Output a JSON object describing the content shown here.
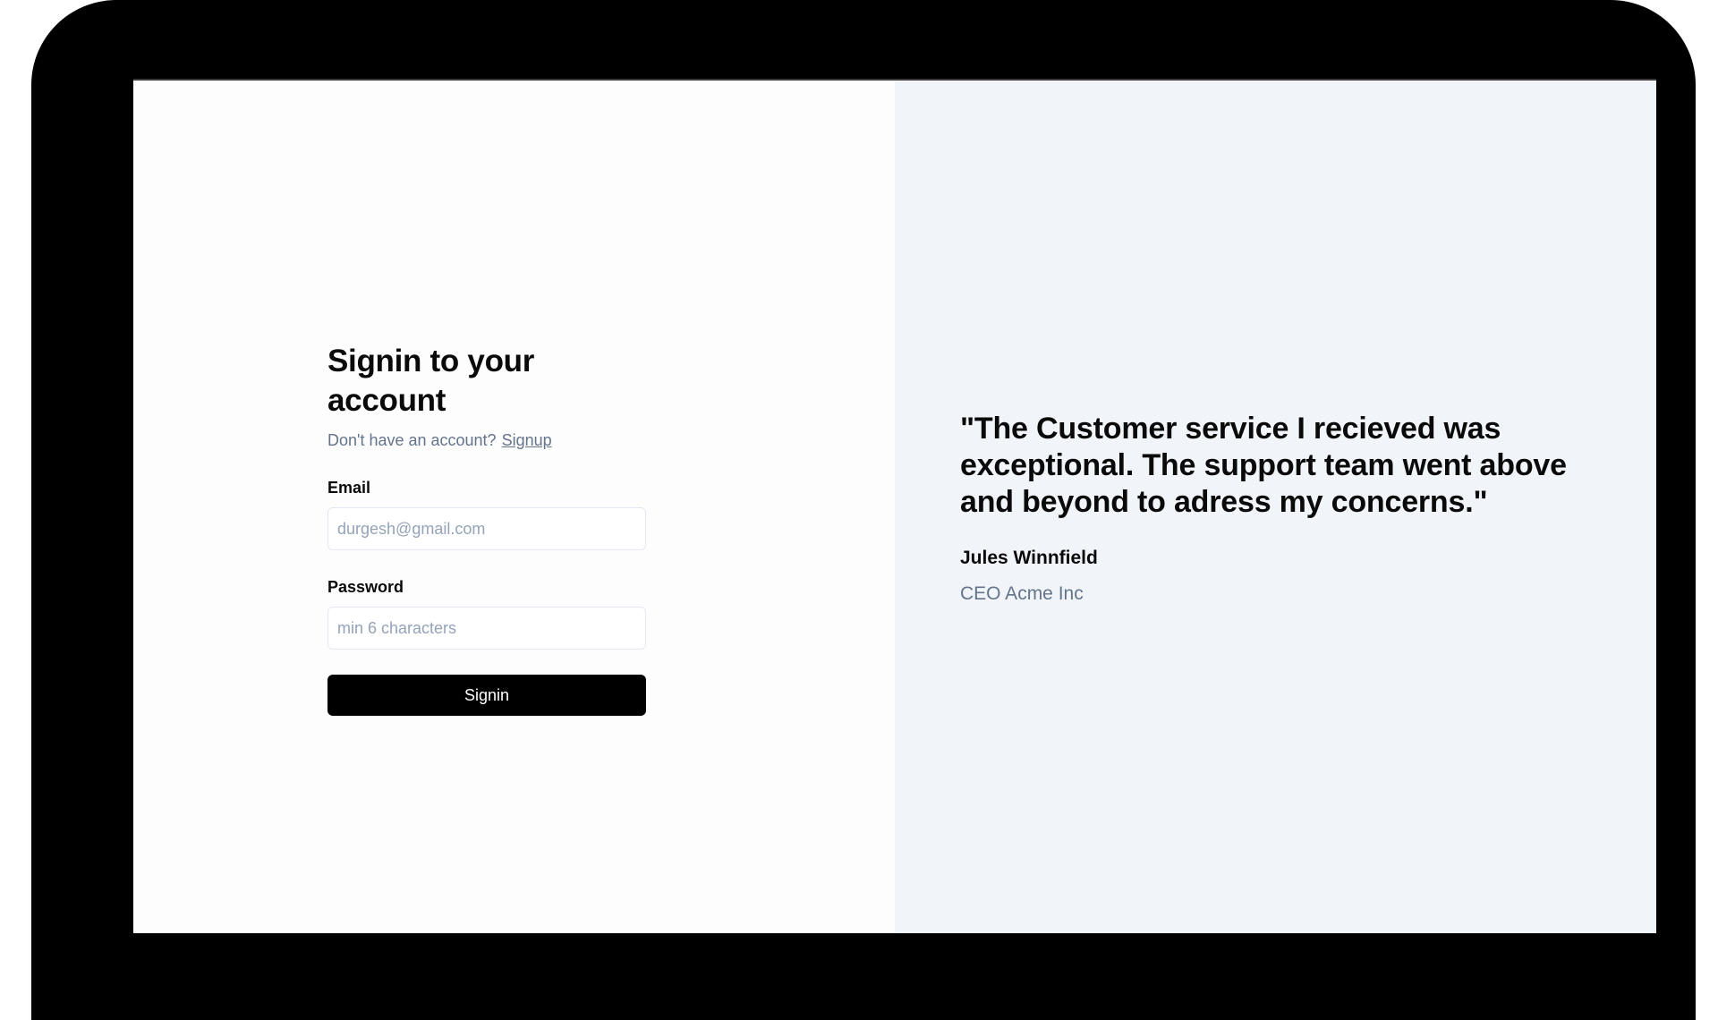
{
  "signin": {
    "title": "Signin to your account",
    "no_account_text": "Don't have an account?",
    "signup_link": "Signup",
    "email_label": "Email",
    "email_placeholder": "durgesh@gmail.com",
    "email_value": "",
    "password_label": "Password",
    "password_placeholder": "min 6 characters",
    "password_value": "",
    "submit_label": "Signin"
  },
  "testimonial": {
    "quote": "\"The Customer service I recieved was exceptional. The support team went above and beyond to adress my concerns.\"",
    "author_name": "Jules Winnfield",
    "author_role": "CEO Acme Inc"
  },
  "colors": {
    "device_frame": "#000000",
    "left_background": "#fdfdfd",
    "right_background": "#f1f5f9",
    "muted_text": "#64748b",
    "primary_button": "#000000"
  }
}
